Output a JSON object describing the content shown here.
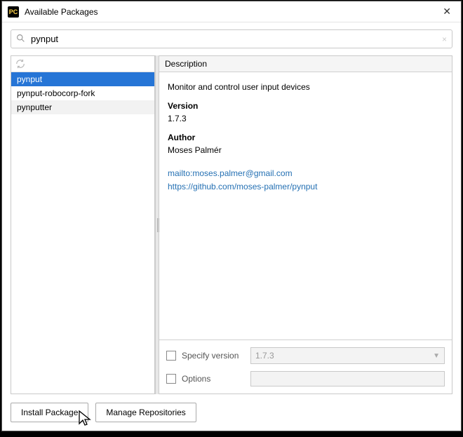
{
  "window": {
    "title": "Available Packages"
  },
  "search": {
    "value": "pynput"
  },
  "packages": [
    {
      "name": "pynput",
      "selected": true
    },
    {
      "name": "pynput-robocorp-fork",
      "selected": false
    },
    {
      "name": "pynputter",
      "selected": false
    }
  ],
  "description": {
    "header": "Description",
    "summary": "Monitor and control user input devices",
    "version_label": "Version",
    "version": "1.7.3",
    "author_label": "Author",
    "author": "Moses Palmér",
    "links": {
      "mailto": "mailto:moses.palmer@gmail.com",
      "repo": "https://github.com/moses-palmer/pynput"
    }
  },
  "options": {
    "specify_version_label": "Specify version",
    "specify_version_value": "1.7.3",
    "options_label": "Options"
  },
  "buttons": {
    "install": "Install Package",
    "manage": "Manage Repositories"
  }
}
